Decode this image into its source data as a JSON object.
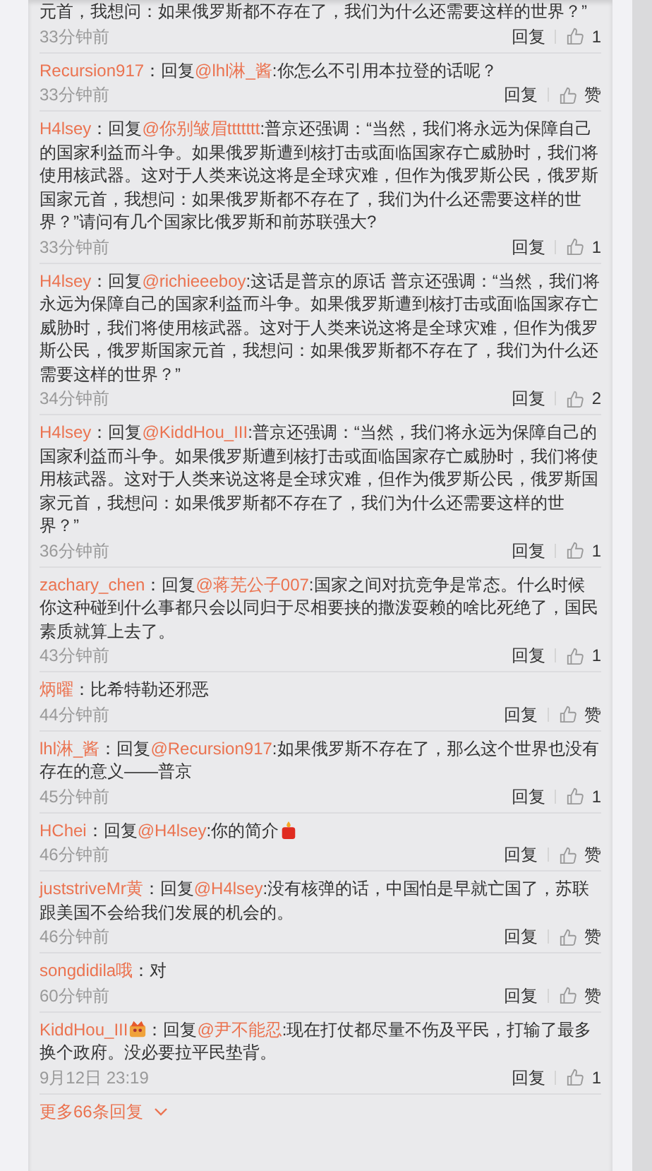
{
  "comments": [
    {
      "text": "元首，我想问：如果俄罗斯都不存在了，我们为什么还需要这样的世界？”",
      "time": "33分钟前",
      "reply": "回复",
      "like": "1"
    },
    {
      "user": "Recursion917",
      "prefix": "：回复",
      "reply_to": "@lhl淋_酱",
      "text": ":你怎么不引用本拉登的话呢？",
      "time": "33分钟前",
      "reply": "回复",
      "like": "赞"
    },
    {
      "user": "H4lsey",
      "prefix": "：回复",
      "reply_to": "@你别皱眉ttttttt",
      "text": ":普京还强调：“当然，我们将永远为保障自己的国家利益而斗争。如果俄罗斯遭到核打击或面临国家存亡威胁时，我们将使用核武器。这对于人类来说这将是全球灾难，但作为俄罗斯公民，俄罗斯国家元首，我想问：如果俄罗斯都不存在了，我们为什么还需要这样的世界？”请问有几个国家比俄罗斯和前苏联强大?",
      "time": "33分钟前",
      "reply": "回复",
      "like": "1"
    },
    {
      "user": "H4lsey",
      "prefix": "：回复",
      "reply_to": "@richieeeboy",
      "text": ":这话是普京的原话 普京还强调：“当然，我们将永远为保障自己的国家利益而斗争。如果俄罗斯遭到核打击或面临国家存亡威胁时，我们将使用核武器。这对于人类来说这将是全球灾难，但作为俄罗斯公民，俄罗斯国家元首，我想问：如果俄罗斯都不存在了，我们为什么还需要这样的世界？”",
      "time": "34分钟前",
      "reply": "回复",
      "like": "2"
    },
    {
      "user": "H4lsey",
      "prefix": "：回复",
      "reply_to": "@KiddHou_III",
      "text": ":普京还强调：“当然，我们将永远为保障自己的国家利益而斗争。如果俄罗斯遭到核打击或面临国家存亡威胁时，我们将使用核武器。这对于人类来说这将是全球灾难，但作为俄罗斯公民，俄罗斯国家元首，我想问：如果俄罗斯都不存在了，我们为什么还需要这样的世界？”",
      "time": "36分钟前",
      "reply": "回复",
      "like": "1"
    },
    {
      "user": "zachary_chen",
      "prefix": "：回复",
      "reply_to": "@蒋芜公子007",
      "text": ":国家之间对抗竞争是常态。什么时候你这种碰到什么事都只会以同归于尽相要挟的撒泼耍赖的啥比死绝了，国民素质就算上去了。",
      "time": "43分钟前",
      "reply": "回复",
      "like": "1"
    },
    {
      "user": "炳曜",
      "prefix": "：",
      "text": "比希特勒还邪恶",
      "time": "44分钟前",
      "reply": "回复",
      "like": "赞"
    },
    {
      "user": "lhl淋_酱",
      "prefix": "：回复",
      "reply_to": "@Recursion917",
      "text": ":如果俄罗斯不存在了，那么这个世界也没有存在的意义——普京",
      "time": "45分钟前",
      "reply": "回复",
      "like": "1"
    },
    {
      "user": "HChei",
      "prefix": "：回复",
      "reply_to": "@H4lsey",
      "text": ":你的简介",
      "text_icon": true,
      "time": "46分钟前",
      "reply": "回复",
      "like": "赞"
    },
    {
      "user": "juststriveMr黄",
      "prefix": "：回复",
      "reply_to": "@H4lsey",
      "text": ":没有核弹的话，中国怕是早就亡国了，苏联跟美国不会给我们发展的机会的。",
      "time": "46分钟前",
      "reply": "回复",
      "like": "赞"
    },
    {
      "user": "songdidila哦",
      "prefix": "：",
      "text": "对",
      "time": "60分钟前",
      "reply": "回复",
      "like": "赞"
    },
    {
      "user": "KiddHou_III",
      "user_badge": true,
      "prefix": "：回复",
      "reply_to": "@尹不能忍",
      "text": ":现在打仗都尽量不伤及平民，打输了最多换个政府。没必要拉平民垫背。",
      "time": "9月12日 23:19",
      "reply": "回复",
      "like": "1"
    }
  ],
  "more": "更多66条回复"
}
